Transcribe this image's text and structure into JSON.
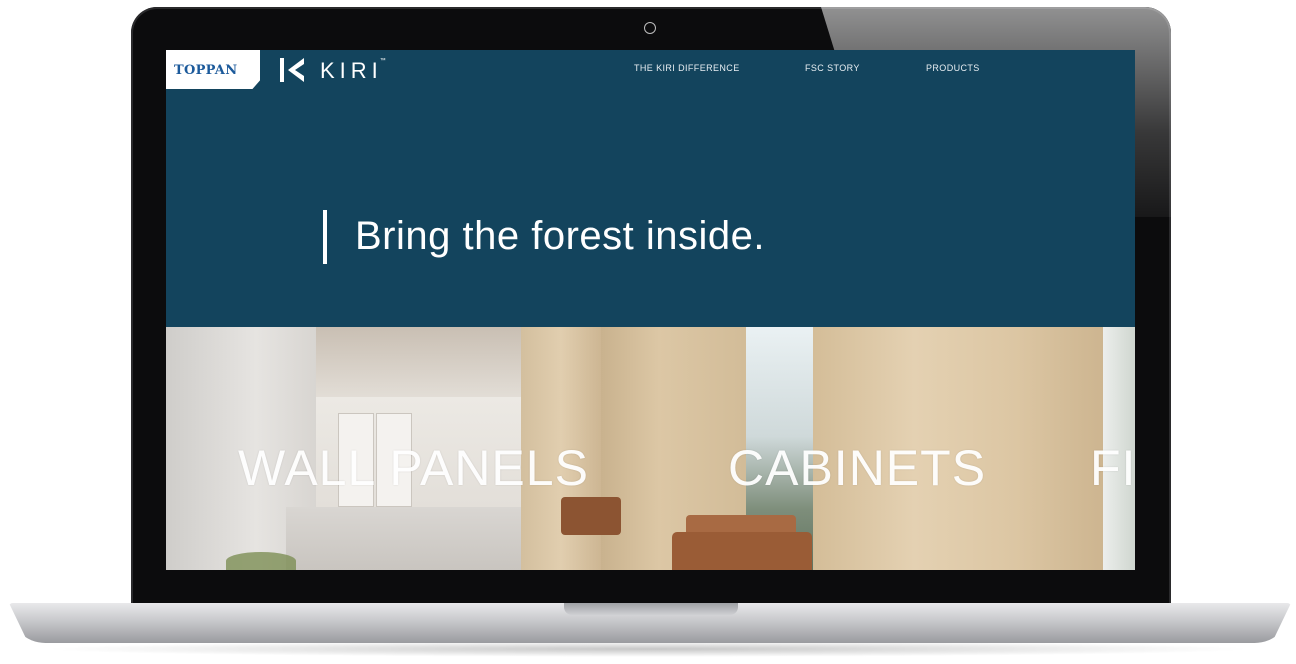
{
  "brand": {
    "parent_logo": "TOPPAN",
    "product_logo": "KIRI",
    "trademark": "™"
  },
  "nav": {
    "items": [
      {
        "label": "THE KIRI DIFFERENCE"
      },
      {
        "label": "FSC STORY"
      },
      {
        "label": "PRODUCTS"
      }
    ]
  },
  "hero": {
    "headline": "Bring the forest inside."
  },
  "categories": [
    {
      "label": "WALL PANELS"
    },
    {
      "label": "CABINETS"
    },
    {
      "label": "FI"
    }
  ],
  "colors": {
    "hero_background": "#13445d",
    "toppan_blue": "#1c5a9b",
    "text_white": "#ffffff"
  },
  "icons": {
    "kiri_mark": "kiri-logo-icon",
    "camera": "camera-icon"
  }
}
